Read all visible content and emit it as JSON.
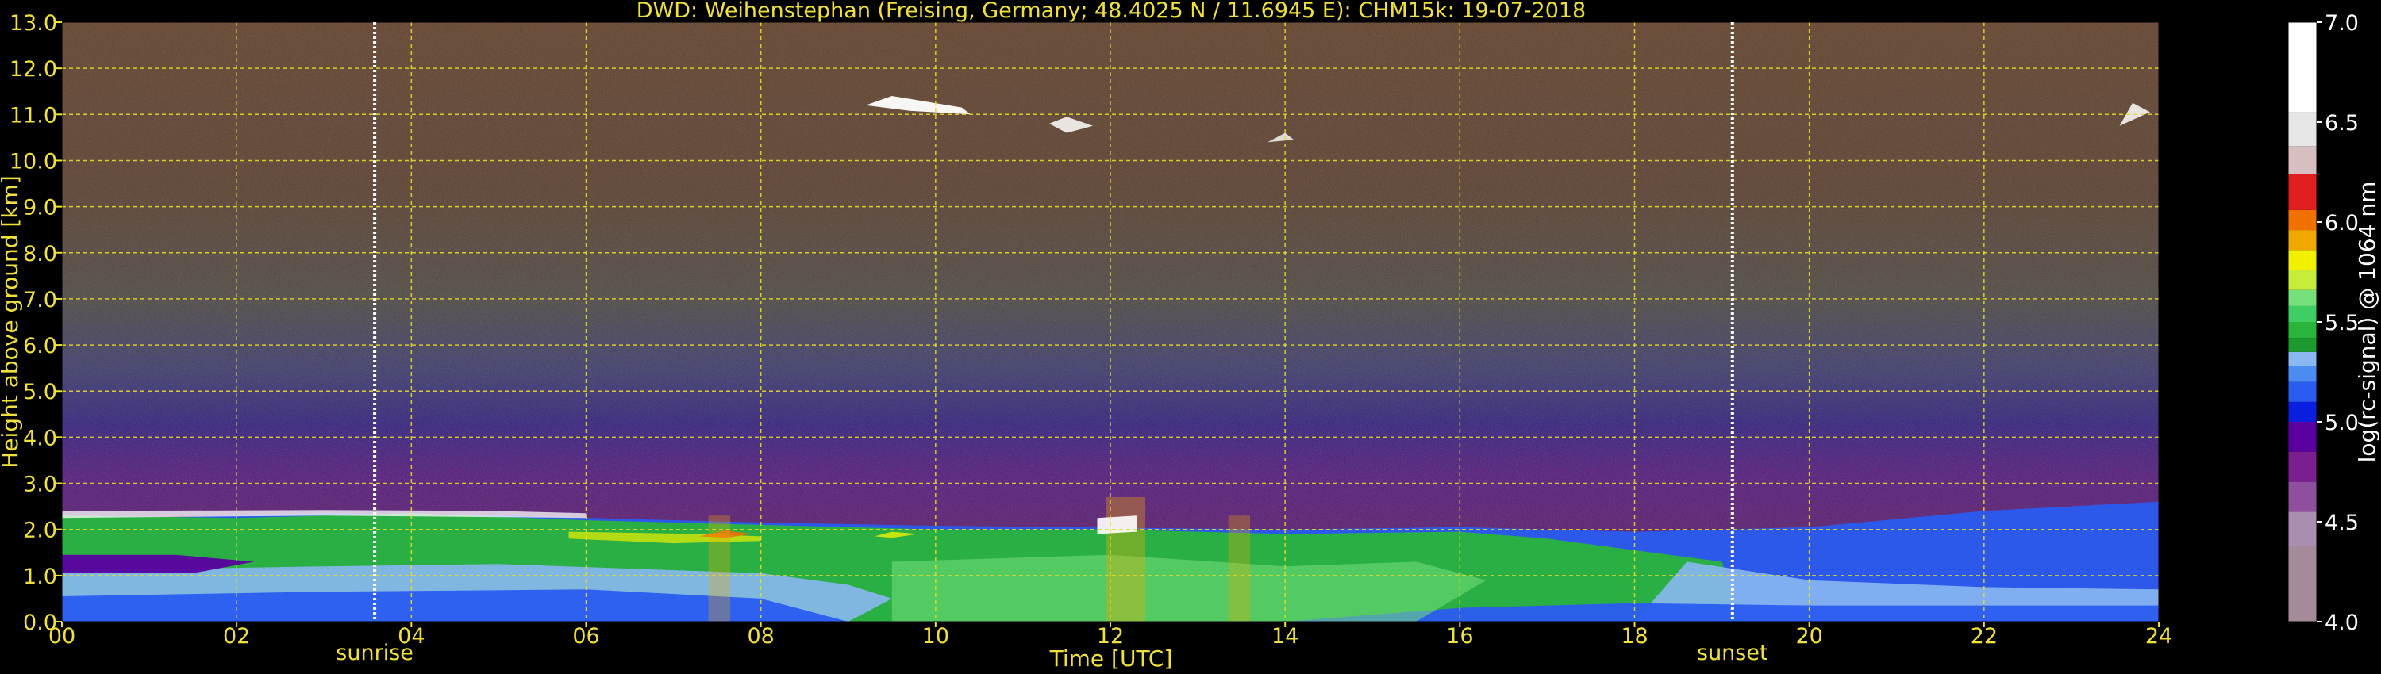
{
  "chart_data": {
    "type": "heatmap",
    "title": "DWD: Weihenstephan (Freising, Germany; 48.4025 N / 11.6945 E):    CHM15k: 19-07-2018",
    "xlabel": "Time [UTC]",
    "ylabel": "Height above ground [km]",
    "xlim": [
      0,
      24
    ],
    "ylim": [
      0,
      13
    ],
    "x_ticks": [
      0,
      2,
      4,
      6,
      8,
      10,
      12,
      14,
      16,
      18,
      20,
      22,
      24
    ],
    "x_tick_labels": [
      "00",
      "02",
      "04",
      "06",
      "08",
      "10",
      "12",
      "14",
      "16",
      "18",
      "20",
      "22",
      "24"
    ],
    "y_ticks": [
      0,
      1,
      2,
      3,
      4,
      5,
      6,
      7,
      8,
      9,
      10,
      11,
      12,
      13
    ],
    "y_tick_labels": [
      "0.0",
      "1.0",
      "2.0",
      "3.0",
      "4.0",
      "5.0",
      "6.0",
      "7.0",
      "8.0",
      "9.0",
      "10.0",
      "11.0",
      "12.0",
      "13.0"
    ],
    "grid": true,
    "markers": [
      {
        "label": "sunrise",
        "x": 3.58
      },
      {
        "label": "sunset",
        "x": 19.12
      }
    ],
    "colorbar": {
      "label": "log(rc-signal) @ 1064 nm",
      "range": [
        4.0,
        7.0
      ],
      "ticks": [
        4.0,
        4.5,
        5.0,
        5.5,
        6.0,
        6.5,
        7.0
      ],
      "tick_labels": [
        "4.0",
        "4.5",
        "5.0",
        "5.5",
        "6.0",
        "6.5",
        "7.0"
      ],
      "bands": [
        {
          "from": 4.0,
          "to": 4.38,
          "color": "#a58a9a"
        },
        {
          "from": 4.38,
          "to": 4.55,
          "color": "#aa8eb2"
        },
        {
          "from": 4.55,
          "to": 4.7,
          "color": "#8e4f9e"
        },
        {
          "from": 4.7,
          "to": 4.85,
          "color": "#7a1e90"
        },
        {
          "from": 4.85,
          "to": 5.0,
          "color": "#5a00a0"
        },
        {
          "from": 5.0,
          "to": 5.1,
          "color": "#0a1ee0"
        },
        {
          "from": 5.1,
          "to": 5.2,
          "color": "#2a5cf0"
        },
        {
          "from": 5.2,
          "to": 5.28,
          "color": "#4a8cf0"
        },
        {
          "from": 5.28,
          "to": 5.35,
          "color": "#8ab8f2"
        },
        {
          "from": 5.35,
          "to": 5.42,
          "color": "#1c9a2e"
        },
        {
          "from": 5.42,
          "to": 5.5,
          "color": "#2ab43c"
        },
        {
          "from": 5.5,
          "to": 5.58,
          "color": "#3ece64"
        },
        {
          "from": 5.58,
          "to": 5.66,
          "color": "#76e07a"
        },
        {
          "from": 5.66,
          "to": 5.76,
          "color": "#c8ec3a"
        },
        {
          "from": 5.76,
          "to": 5.86,
          "color": "#f0f000"
        },
        {
          "from": 5.86,
          "to": 5.96,
          "color": "#f0a800"
        },
        {
          "from": 5.96,
          "to": 6.06,
          "color": "#f07000"
        },
        {
          "from": 6.06,
          "to": 6.24,
          "color": "#e02020"
        },
        {
          "from": 6.24,
          "to": 6.38,
          "color": "#d8bec0"
        },
        {
          "from": 6.38,
          "to": 6.55,
          "color": "#e6e6e6"
        },
        {
          "from": 6.55,
          "to": 7.0,
          "color": "#ffffff"
        }
      ]
    },
    "colors": {
      "text": "#f0e03c",
      "grid": "#e6dc2a",
      "colorbar_text": "#ffffff",
      "background": "#000000"
    }
  }
}
